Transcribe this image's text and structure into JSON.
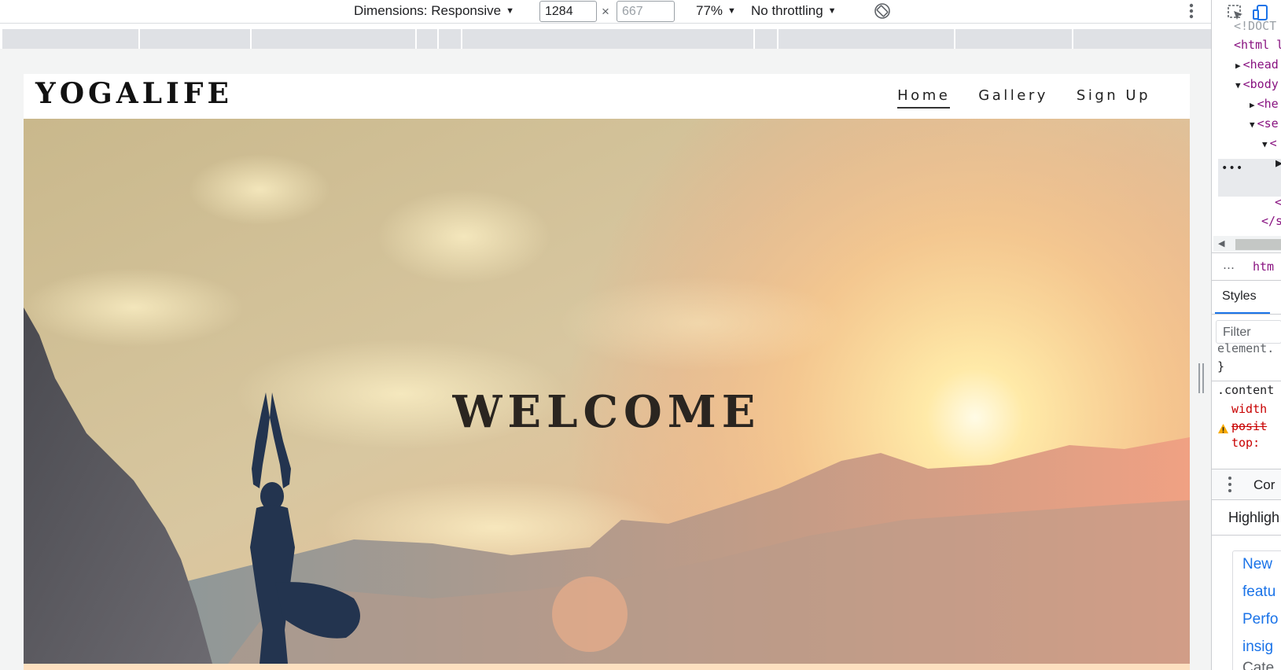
{
  "device_toolbar": {
    "dimensions_label": "Dimensions: Responsive",
    "width_value": "1284",
    "times_symbol": "×",
    "height_value": "667",
    "zoom_label": "77%",
    "throttling_label": "No throttling"
  },
  "site": {
    "logo": "YOGALIFE",
    "nav": [
      {
        "label": "Home",
        "active": true
      },
      {
        "label": "Gallery",
        "active": false
      },
      {
        "label": "Sign Up",
        "active": false
      }
    ],
    "hero_heading": "WELCOME"
  },
  "devtools": {
    "elements": [
      {
        "text": "<!DOCT"
      },
      {
        "text": "<html l"
      },
      {
        "text": "<head"
      },
      {
        "text": "<body"
      },
      {
        "text": "<he"
      },
      {
        "text": "<se"
      },
      {
        "text": "<"
      },
      {
        "text": "<"
      },
      {
        "text": "</s"
      }
    ],
    "breadcrumb": "htm",
    "styles_tab": "Styles",
    "filter_placeholder": "Filter",
    "rules": {
      "element_selector": "element.",
      "close_brace": "}",
      "content_selector": ".content",
      "prop_width": "width",
      "prop_position": "posit",
      "prop_top": "top:"
    },
    "console_label": "Cor",
    "highlights_label": "Highligh",
    "news": [
      "New",
      "featu",
      "Perfo",
      "insig",
      "Cate"
    ]
  },
  "colors": {
    "tag_purple": "#881280",
    "property_red": "#c80000",
    "link_blue": "#1a73e8",
    "warning_yellow": "#f9ab00"
  }
}
